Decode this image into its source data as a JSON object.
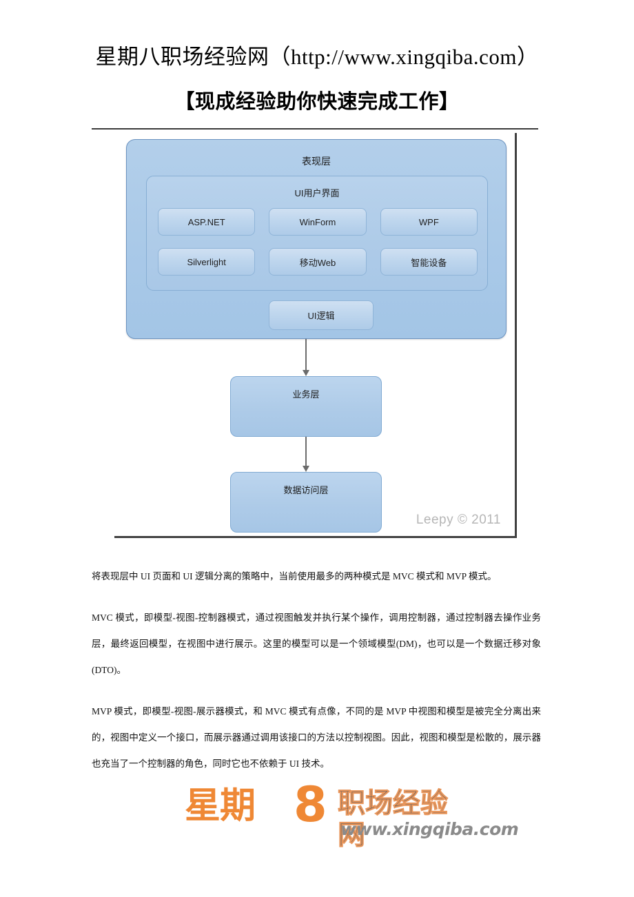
{
  "header": {
    "site_line": "星期八职场经验网（http://www.xingqiba.com）",
    "slogan": "【现成经验助你快速完成工作】"
  },
  "figure": {
    "presentation_layer": "表现层",
    "ui_container": "UI用户界面",
    "tech_boxes": [
      "ASP.NET",
      "WinForm",
      "WPF",
      "Silverlight",
      "移动Web",
      "智能设备"
    ],
    "ui_logic": "UI逻辑",
    "business_layer": "业务层",
    "data_layer": "数据访问层",
    "watermark": "Leepy © 2011"
  },
  "body": {
    "paragraphs": [
      "将表现层中 UI 页面和 UI 逻辑分离的策略中，当前使用最多的两种模式是 MVC 模式和 MVP 模式。",
      "MVC 模式，即模型-视图-控制器模式，通过视图触发并执行某个操作，调用控制器，通过控制器去操作业务层，最终返回模型，在视图中进行展示。这里的模型可以是一个领域模型(DM)，也可以是一个数据迁移对象(DTO)。",
      "MVP 模式，即模型-视图-展示器模式，和 MVC 模式有点像，不同的是 MVP 中视图和模型是被完全分离出来的，视图中定义一个接口，而展示器通过调用该接口的方法以控制视图。因此，视图和模型是松散的，展示器也充当了一个控制器的角色，同时它也不依赖于 UI 技术。"
    ]
  },
  "footer_logo": {
    "brand_cn": "星期",
    "brand_eight": "8",
    "brand_tagline": "职场经验网",
    "url": "www.xingqiba.com"
  },
  "colors": {
    "layer_fill": "#aecbe8",
    "layer_border": "#6a92c0",
    "connector": "#6b6b6b",
    "watermark": "#b6b6b6",
    "logo_orange": "#ef8835",
    "logo_gray": "#5d5d5d"
  }
}
